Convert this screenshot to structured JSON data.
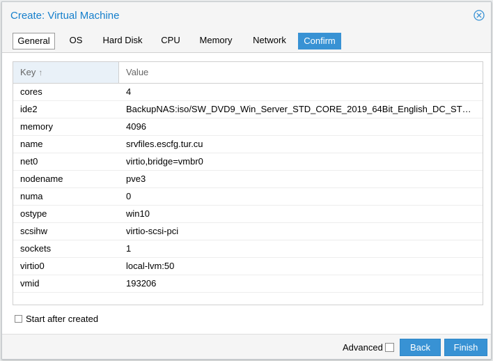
{
  "dialog": {
    "title": "Create: Virtual Machine",
    "close_icon": "close-circle-icon"
  },
  "tabs": [
    {
      "label": "General",
      "state": "selected"
    },
    {
      "label": "OS",
      "state": "normal"
    },
    {
      "label": "Hard Disk",
      "state": "normal"
    },
    {
      "label": "CPU",
      "state": "normal"
    },
    {
      "label": "Memory",
      "state": "normal"
    },
    {
      "label": "Network",
      "state": "normal"
    },
    {
      "label": "Confirm",
      "state": "active"
    }
  ],
  "grid": {
    "columns": {
      "key": "Key",
      "value": "Value"
    },
    "sort_icon": "arrow-up-icon",
    "rows": [
      {
        "key": "cores",
        "value": "4"
      },
      {
        "key": "ide2",
        "value": "BackupNAS:iso/SW_DVD9_Win_Server_STD_CORE_2019_64Bit_English_DC_STD..."
      },
      {
        "key": "memory",
        "value": "4096"
      },
      {
        "key": "name",
        "value": "srvfiles.escfg.tur.cu"
      },
      {
        "key": "net0",
        "value": "virtio,bridge=vmbr0"
      },
      {
        "key": "nodename",
        "value": "pve3"
      },
      {
        "key": "numa",
        "value": "0"
      },
      {
        "key": "ostype",
        "value": "win10"
      },
      {
        "key": "scsihw",
        "value": "virtio-scsi-pci"
      },
      {
        "key": "sockets",
        "value": "1"
      },
      {
        "key": "virtio0",
        "value": "local-lvm:50"
      },
      {
        "key": "vmid",
        "value": "193206"
      }
    ]
  },
  "options": {
    "start_after_created_label": "Start after created",
    "start_after_created_checked": false
  },
  "footer": {
    "advanced_label": "Advanced",
    "advanced_checked": false,
    "back_label": "Back",
    "finish_label": "Finish"
  },
  "colors": {
    "accent": "#3892d4",
    "title": "#157fcc"
  }
}
